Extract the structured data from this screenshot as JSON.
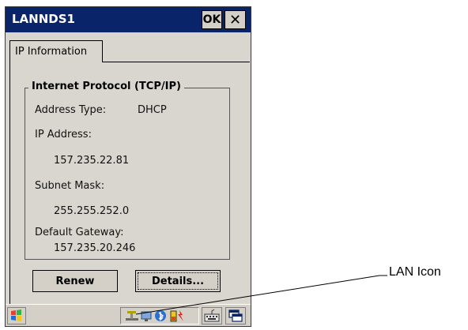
{
  "window": {
    "title": "LANNDS1",
    "ok_label": "OK",
    "close_glyph": "✕"
  },
  "tabs": [
    {
      "label": "IP Information"
    }
  ],
  "group": {
    "title": "Internet Protocol (TCP/IP)",
    "address_type_label": "Address Type:",
    "address_type_value": "DHCP",
    "ip_label": "IP Address:",
    "ip_value": "157.235.22.81",
    "subnet_label": "Subnet Mask:",
    "subnet_value": "255.255.252.0",
    "gateway_label": "Default Gateway:",
    "gateway_value": "157.235.20.246"
  },
  "buttons": {
    "renew": "Renew",
    "details": "Details..."
  },
  "taskbar": {
    "tray_icons": [
      "lan-icon",
      "network-icon",
      "bluetooth-icon",
      "battery-icon"
    ],
    "keyboard_icon": "keyboard-icon",
    "switch_icon": "window-switch-icon"
  },
  "callout": {
    "label": "LAN Icon"
  }
}
